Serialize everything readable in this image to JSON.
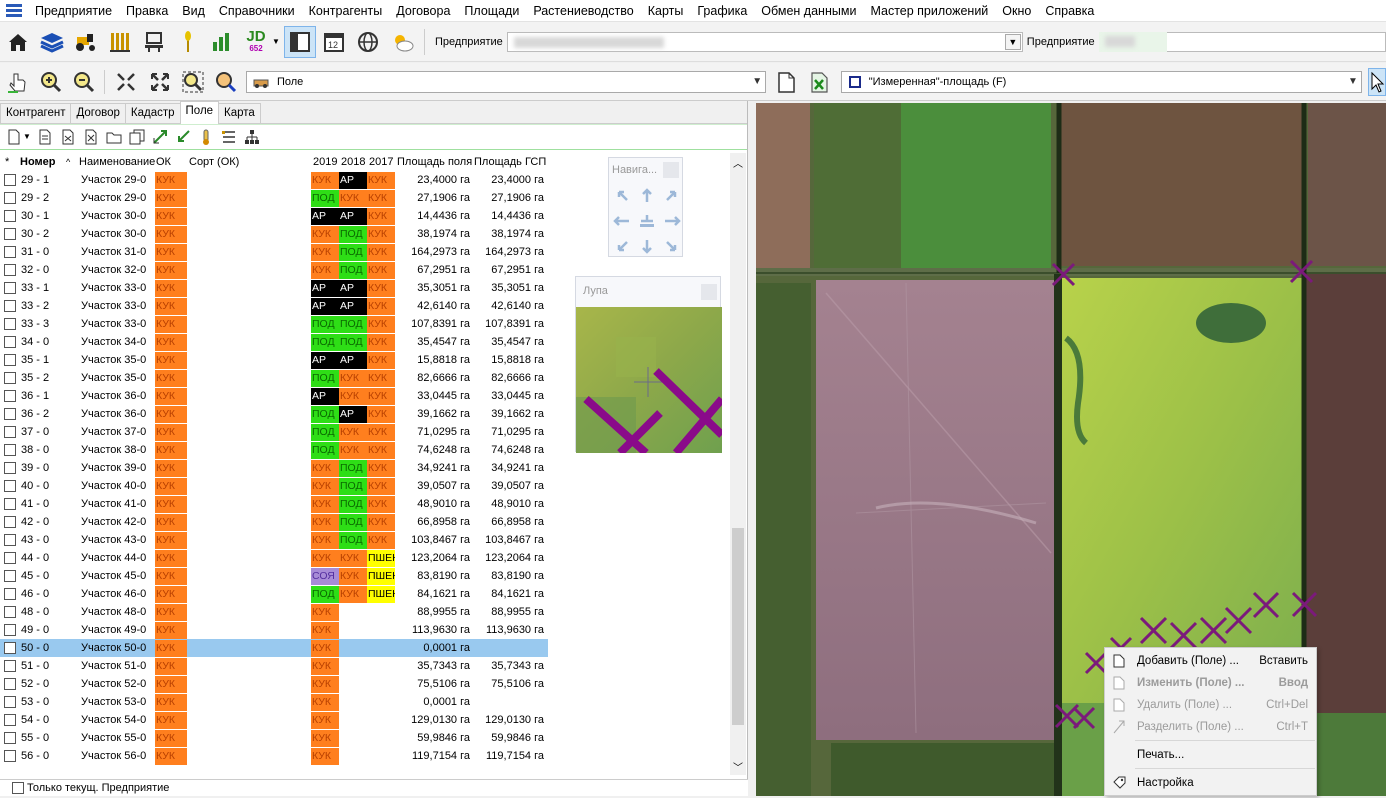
{
  "menu": [
    "Предприятие",
    "Правка",
    "Вид",
    "Справочники",
    "Контрагенты",
    "Договора",
    "Площади",
    "Растениеводство",
    "Карты",
    "Графика",
    "Обмен данными",
    "Мастер приложений",
    "Окно",
    "Справка"
  ],
  "toolbar": {
    "enterprise_label": "Предприятие",
    "enterprise_label2": "Предприятие",
    "jd_text": "JD",
    "jd_sub": "652"
  },
  "toolbar2": {
    "layer_combo": "Поле",
    "measure_combo": "\"Измеренная\"-площадь (F)"
  },
  "tabs": [
    "Контрагент",
    "Договор",
    "Кадастр",
    "Поле",
    "Карта"
  ],
  "grid": {
    "headers": {
      "star": "*",
      "number": "Номер",
      "name": "Наименование",
      "ok": "ОК",
      "sort": "Сорт (ОК)",
      "y2019": "2019",
      "y2018": "2018",
      "y2017": "2017",
      "area": "Площадь поля",
      "gsp": "Площадь ГСП"
    },
    "rows": [
      {
        "num": "29 - 1",
        "name": "Участок 29-0",
        "ok": "КУК",
        "c": [
          "КУК",
          "АР",
          "КУК"
        ],
        "area": "23,4000 га",
        "gsp": "23,4000 га"
      },
      {
        "num": "29 - 2",
        "name": "Участок 29-0",
        "ok": "КУК",
        "c": [
          "ПОД",
          "КУК",
          "КУК"
        ],
        "area": "27,1906 га",
        "gsp": "27,1906 га"
      },
      {
        "num": "30 - 1",
        "name": "Участок 30-0",
        "ok": "КУК",
        "c": [
          "АР",
          "АР",
          "КУК"
        ],
        "area": "14,4436 га",
        "gsp": "14,4436 га"
      },
      {
        "num": "30 - 2",
        "name": "Участок 30-0",
        "ok": "КУК",
        "c": [
          "КУК",
          "ПОД",
          "КУК"
        ],
        "area": "38,1974 га",
        "gsp": "38,1974 га"
      },
      {
        "num": "31 - 0",
        "name": "Участок 31-0",
        "ok": "КУК",
        "c": [
          "КУК",
          "ПОД",
          "КУК"
        ],
        "area": "164,2973 га",
        "gsp": "164,2973 га"
      },
      {
        "num": "32 - 0",
        "name": "Участок 32-0",
        "ok": "КУК",
        "c": [
          "КУК",
          "ПОД",
          "КУК"
        ],
        "area": "67,2951 га",
        "gsp": "67,2951 га"
      },
      {
        "num": "33 - 1",
        "name": "Участок 33-0",
        "ok": "КУК",
        "c": [
          "АР",
          "АР",
          "КУК"
        ],
        "area": "35,3051 га",
        "gsp": "35,3051 га"
      },
      {
        "num": "33 - 2",
        "name": "Участок 33-0",
        "ok": "КУК",
        "c": [
          "АР",
          "АР",
          "КУК"
        ],
        "area": "42,6140 га",
        "gsp": "42,6140 га"
      },
      {
        "num": "33 - 3",
        "name": "Участок 33-0",
        "ok": "КУК",
        "c": [
          "ПОД",
          "ПОД",
          "КУК"
        ],
        "area": "107,8391 га",
        "gsp": "107,8391 га"
      },
      {
        "num": "34 - 0",
        "name": "Участок 34-0",
        "ok": "КУК",
        "c": [
          "ПОД",
          "ПОД",
          "КУК"
        ],
        "area": "35,4547 га",
        "gsp": "35,4547 га"
      },
      {
        "num": "35 - 1",
        "name": "Участок 35-0",
        "ok": "КУК",
        "c": [
          "АР",
          "АР",
          "КУК"
        ],
        "area": "15,8818 га",
        "gsp": "15,8818 га"
      },
      {
        "num": "35 - 2",
        "name": "Участок 35-0",
        "ok": "КУК",
        "c": [
          "ПОД",
          "КУК",
          "КУК"
        ],
        "area": "82,6666 га",
        "gsp": "82,6666 га"
      },
      {
        "num": "36 - 1",
        "name": "Участок 36-0",
        "ok": "КУК",
        "c": [
          "АР",
          "КУК",
          "КУК"
        ],
        "area": "33,0445 га",
        "gsp": "33,0445 га"
      },
      {
        "num": "36 - 2",
        "name": "Участок 36-0",
        "ok": "КУК",
        "c": [
          "ПОД",
          "АР",
          "КУК"
        ],
        "area": "39,1662 га",
        "gsp": "39,1662 га"
      },
      {
        "num": "37 - 0",
        "name": "Участок 37-0",
        "ok": "КУК",
        "c": [
          "ПОД",
          "КУК",
          "КУК"
        ],
        "area": "71,0295 га",
        "gsp": "71,0295 га"
      },
      {
        "num": "38 - 0",
        "name": "Участок 38-0",
        "ok": "КУК",
        "c": [
          "ПОД",
          "КУК",
          "КУК"
        ],
        "area": "74,6248 га",
        "gsp": "74,6248 га"
      },
      {
        "num": "39 - 0",
        "name": "Участок 39-0",
        "ok": "КУК",
        "c": [
          "КУК",
          "ПОД",
          "КУК"
        ],
        "area": "34,9241 га",
        "gsp": "34,9241 га"
      },
      {
        "num": "40 - 0",
        "name": "Участок 40-0",
        "ok": "КУК",
        "c": [
          "КУК",
          "ПОД",
          "КУК"
        ],
        "area": "39,0507 га",
        "gsp": "39,0507 га"
      },
      {
        "num": "41 - 0",
        "name": "Участок 41-0",
        "ok": "КУК",
        "c": [
          "КУК",
          "ПОД",
          "КУК"
        ],
        "area": "48,9010 га",
        "gsp": "48,9010 га"
      },
      {
        "num": "42 - 0",
        "name": "Участок 42-0",
        "ok": "КУК",
        "c": [
          "КУК",
          "ПОД",
          "КУК"
        ],
        "area": "66,8958 га",
        "gsp": "66,8958 га"
      },
      {
        "num": "43 - 0",
        "name": "Участок 43-0",
        "ok": "КУК",
        "c": [
          "КУК",
          "ПОД",
          "КУК"
        ],
        "area": "103,8467 га",
        "gsp": "103,8467 га"
      },
      {
        "num": "44 - 0",
        "name": "Участок 44-0",
        "ok": "КУК",
        "c": [
          "КУК",
          "КУК",
          "ПШЕН"
        ],
        "area": "123,2064 га",
        "gsp": "123,2064 га"
      },
      {
        "num": "45 - 0",
        "name": "Участок 45-0",
        "ok": "КУК",
        "c": [
          "СОЯ",
          "КУК",
          "ПШЕН"
        ],
        "area": "83,8190 га",
        "gsp": "83,8190 га"
      },
      {
        "num": "46 - 0",
        "name": "Участок 46-0",
        "ok": "КУК",
        "c": [
          "ПОД",
          "КУК",
          "ПШЕН"
        ],
        "area": "84,1621 га",
        "gsp": "84,1621 га"
      },
      {
        "num": "48 - 0",
        "name": "Участок 48-0",
        "ok": "КУК",
        "c": [
          "КУК",
          "",
          ""
        ],
        "area": "88,9955 га",
        "gsp": "88,9955 га"
      },
      {
        "num": "49 - 0",
        "name": "Участок 49-0",
        "ok": "КУК",
        "c": [
          "КУК",
          "",
          ""
        ],
        "area": "113,9630 га",
        "gsp": "113,9630 га"
      },
      {
        "num": "50 - 0",
        "name": "Участок 50-0",
        "ok": "КУК",
        "c": [
          "КУК",
          "",
          ""
        ],
        "area": "0,0001 га",
        "gsp": "",
        "selected": true
      },
      {
        "num": "51 - 0",
        "name": "Участок 51-0",
        "ok": "КУК",
        "c": [
          "КУК",
          "",
          ""
        ],
        "area": "35,7343 га",
        "gsp": "35,7343 га"
      },
      {
        "num": "52 - 0",
        "name": "Участок 52-0",
        "ok": "КУК",
        "c": [
          "КУК",
          "",
          ""
        ],
        "area": "75,5106 га",
        "gsp": "75,5106 га"
      },
      {
        "num": "53 - 0",
        "name": "Участок 53-0",
        "ok": "КУК",
        "c": [
          "КУК",
          "",
          ""
        ],
        "area": "0,0001 га",
        "gsp": ""
      },
      {
        "num": "54 - 0",
        "name": "Участок 54-0",
        "ok": "КУК",
        "c": [
          "КУК",
          "",
          ""
        ],
        "area": "129,0130 га",
        "gsp": "129,0130 га"
      },
      {
        "num": "55 - 0",
        "name": "Участок 55-0",
        "ok": "КУК",
        "c": [
          "КУК",
          "",
          ""
        ],
        "area": "59,9846 га",
        "gsp": "59,9846 га"
      },
      {
        "num": "56 - 0",
        "name": "Участок 56-0",
        "ok": "КУК",
        "c": [
          "КУК",
          "",
          ""
        ],
        "area": "119,7154 га",
        "gsp": "119,7154 га"
      }
    ]
  },
  "status": {
    "only_current": "Только текущ. Предприятие"
  },
  "nav_panel": {
    "title": "Навига..."
  },
  "lupa_panel": {
    "title": "Лупа"
  },
  "context_menu": [
    {
      "label": "Добавить (Поле) ...",
      "shortcut": "Вставить",
      "disabled": false,
      "icon": "new-doc-icon"
    },
    {
      "label": "Изменить (Поле) ...",
      "shortcut": "Ввод",
      "disabled": true,
      "icon": "edit-doc-icon"
    },
    {
      "label": "Удалить (Поле) ...",
      "shortcut": "Ctrl+Del",
      "disabled": true,
      "icon": "delete-doc-icon"
    },
    {
      "label": "Разделить (Поле) ...",
      "shortcut": "Ctrl+T",
      "disabled": true,
      "icon": "split-icon"
    },
    {
      "label": "Печать...",
      "shortcut": "",
      "disabled": false,
      "icon": ""
    },
    {
      "label": "Настройка",
      "shortcut": "",
      "disabled": false,
      "icon": "settings-tag-icon"
    }
  ],
  "colors": {
    "КУК": "#ff7f1e",
    "ПОД": "#2ede16",
    "АР": "#000000",
    "ПШЕН": "#ffff00",
    "СОЯ": "#a78bd6",
    "selected_row": "#99c9ef"
  }
}
